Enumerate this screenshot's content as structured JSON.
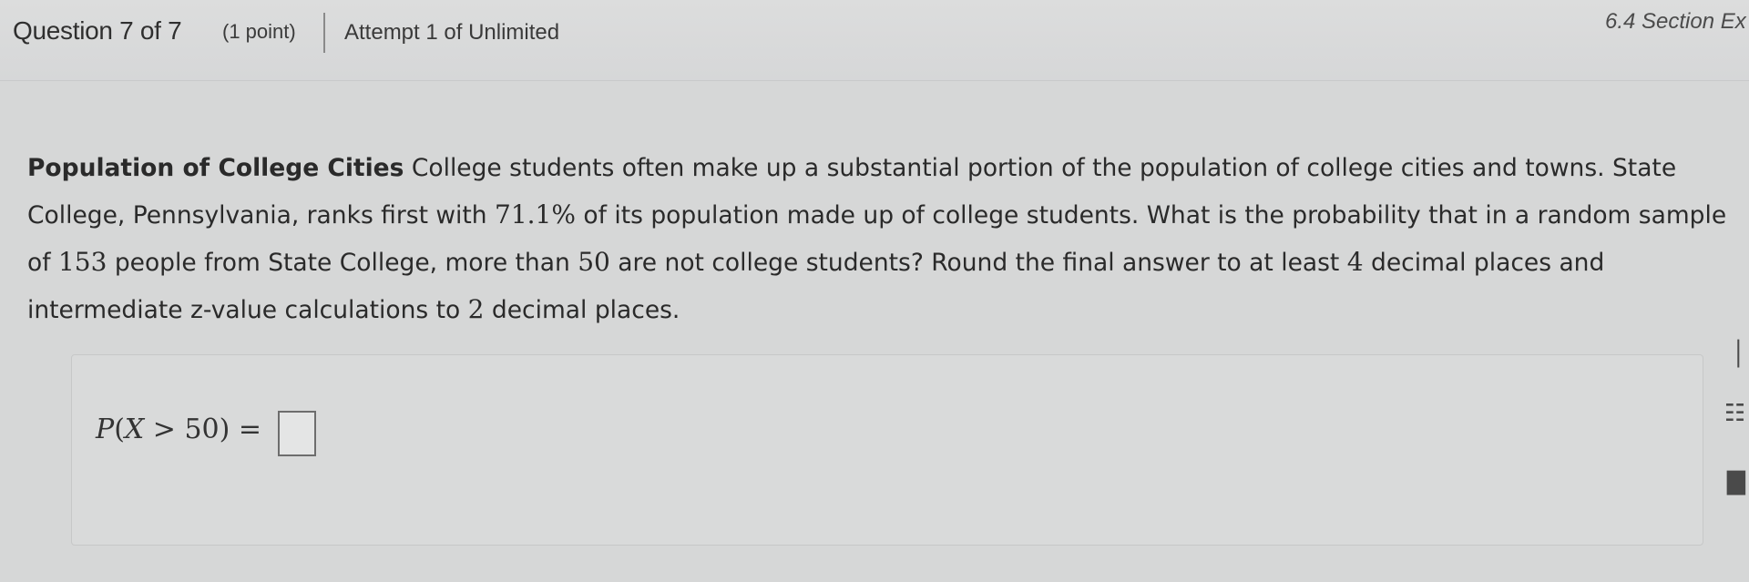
{
  "header": {
    "question_label": "Question 7 of 7",
    "points": "(1 point)",
    "attempt": "Attempt 1 of Unlimited",
    "section_link": "6.4 Section Ex"
  },
  "problem": {
    "lead": "Population of College Cities",
    "text_1": " College students often make up a substantial portion of the population of college cities and towns. State College, Pennsylvania, ranks first with ",
    "percent": "71.1%",
    "text_2": " of its population made up of college students. What is the probability that in a random sample of ",
    "sample_size": "153",
    "text_3": " people from State College, more than ",
    "threshold": "50",
    "text_4": " are not college students? Round the final answer to at least ",
    "decimals_final": "4",
    "text_5": " decimal places and intermediate z-value calculations to ",
    "decimals_z": "2",
    "text_6": " decimal places."
  },
  "answer": {
    "formula_prefix": "P",
    "formula_open": "(",
    "formula_var": "X",
    "formula_rel": " > 50",
    "formula_close": ") =",
    "value": ""
  }
}
